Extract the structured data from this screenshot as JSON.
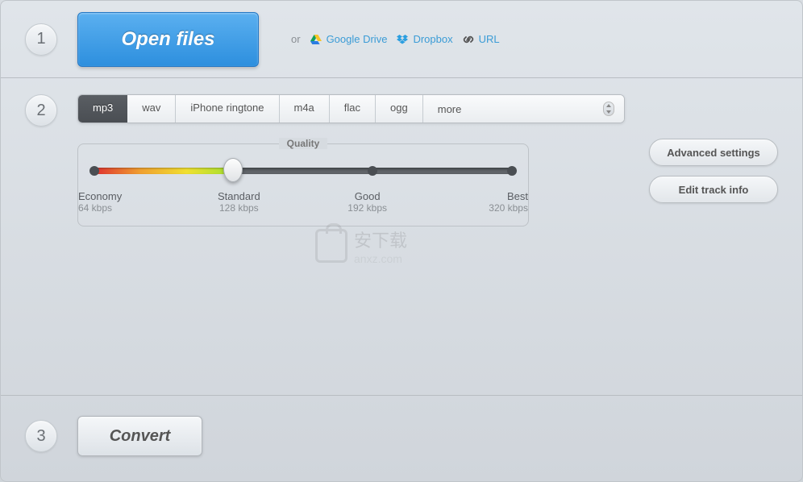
{
  "steps": {
    "one": "1",
    "two": "2",
    "three": "3"
  },
  "open_files": {
    "button_label": "Open files",
    "or": "or",
    "google_drive": "Google Drive",
    "dropbox": "Dropbox",
    "url": "URL"
  },
  "formats": {
    "mp3": "mp3",
    "wav": "wav",
    "iphone": "iPhone ringtone",
    "m4a": "m4a",
    "flac": "flac",
    "ogg": "ogg",
    "more": "more"
  },
  "quality": {
    "title": "Quality",
    "levels": [
      {
        "name": "Economy",
        "rate": "64 kbps"
      },
      {
        "name": "Standard",
        "rate": "128 kbps"
      },
      {
        "name": "Good",
        "rate": "192 kbps"
      },
      {
        "name": "Best",
        "rate": "320 kbps"
      }
    ],
    "selected_index": 1
  },
  "side": {
    "advanced": "Advanced settings",
    "edit_track": "Edit track info"
  },
  "convert": {
    "label": "Convert"
  },
  "watermark": {
    "main": "安下载",
    "sub": "anxz.com"
  }
}
